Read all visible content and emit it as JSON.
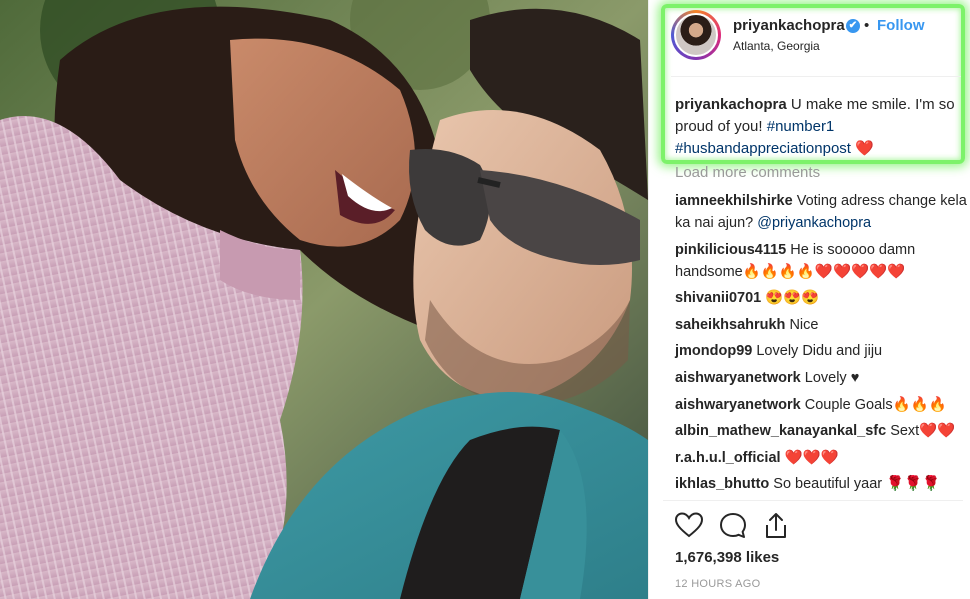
{
  "post": {
    "username": "priyankachopra",
    "verified_mark": "✔",
    "separator": "•",
    "follow_label": "Follow",
    "location": "Atlanta, Georgia",
    "caption": {
      "username": "priyankachopra",
      "text": " U make me smile. I'm so proud of you! ",
      "hashtag1": "#number1",
      "hashtag2": "#husbandappreciationpost",
      "emoji": "❤️"
    },
    "load_more": "Load more comments",
    "comments": [
      {
        "user": "iamneekhilshirke",
        "text": " Voting adress change kela ka nai ajun? ",
        "mention": "@priyankachopra"
      },
      {
        "user": "pinkilicious4115",
        "text": " He is sooooo damn handsome🔥🔥🔥🔥❤️❤️❤️❤️❤️",
        "mention": ""
      },
      {
        "user": "shivanii0701",
        "text": " 😍😍😍",
        "mention": ""
      },
      {
        "user": "saheikhsahrukh",
        "text": " Nice",
        "mention": ""
      },
      {
        "user": "jmondop99",
        "text": " Lovely Didu and jiju",
        "mention": ""
      },
      {
        "user": "aishwaryanetwork",
        "text": " Lovely ♥",
        "mention": ""
      },
      {
        "user": "aishwaryanetwork",
        "text": " Couple Goals🔥🔥🔥",
        "mention": ""
      },
      {
        "user": "albin_mathew_kanayankal_sfc",
        "text": " Sext❤️❤️",
        "mention": ""
      },
      {
        "user": "r.a.h.u.l_official",
        "text": " ❤️❤️❤️",
        "mention": ""
      },
      {
        "user": "ikhlas_bhutto",
        "text": " So beautiful yaar 🌹🌹🌹",
        "mention": ""
      }
    ],
    "likes": "1,676,398 likes",
    "time": "12 HOURS AGO"
  },
  "icons": {
    "like": "heart-outline-icon",
    "comment": "comment-bubble-icon",
    "share": "share-upload-icon"
  },
  "colors": {
    "link": "#3897f0",
    "hashtag": "#003569",
    "highlight": "#7df26a",
    "muted": "#999999"
  }
}
